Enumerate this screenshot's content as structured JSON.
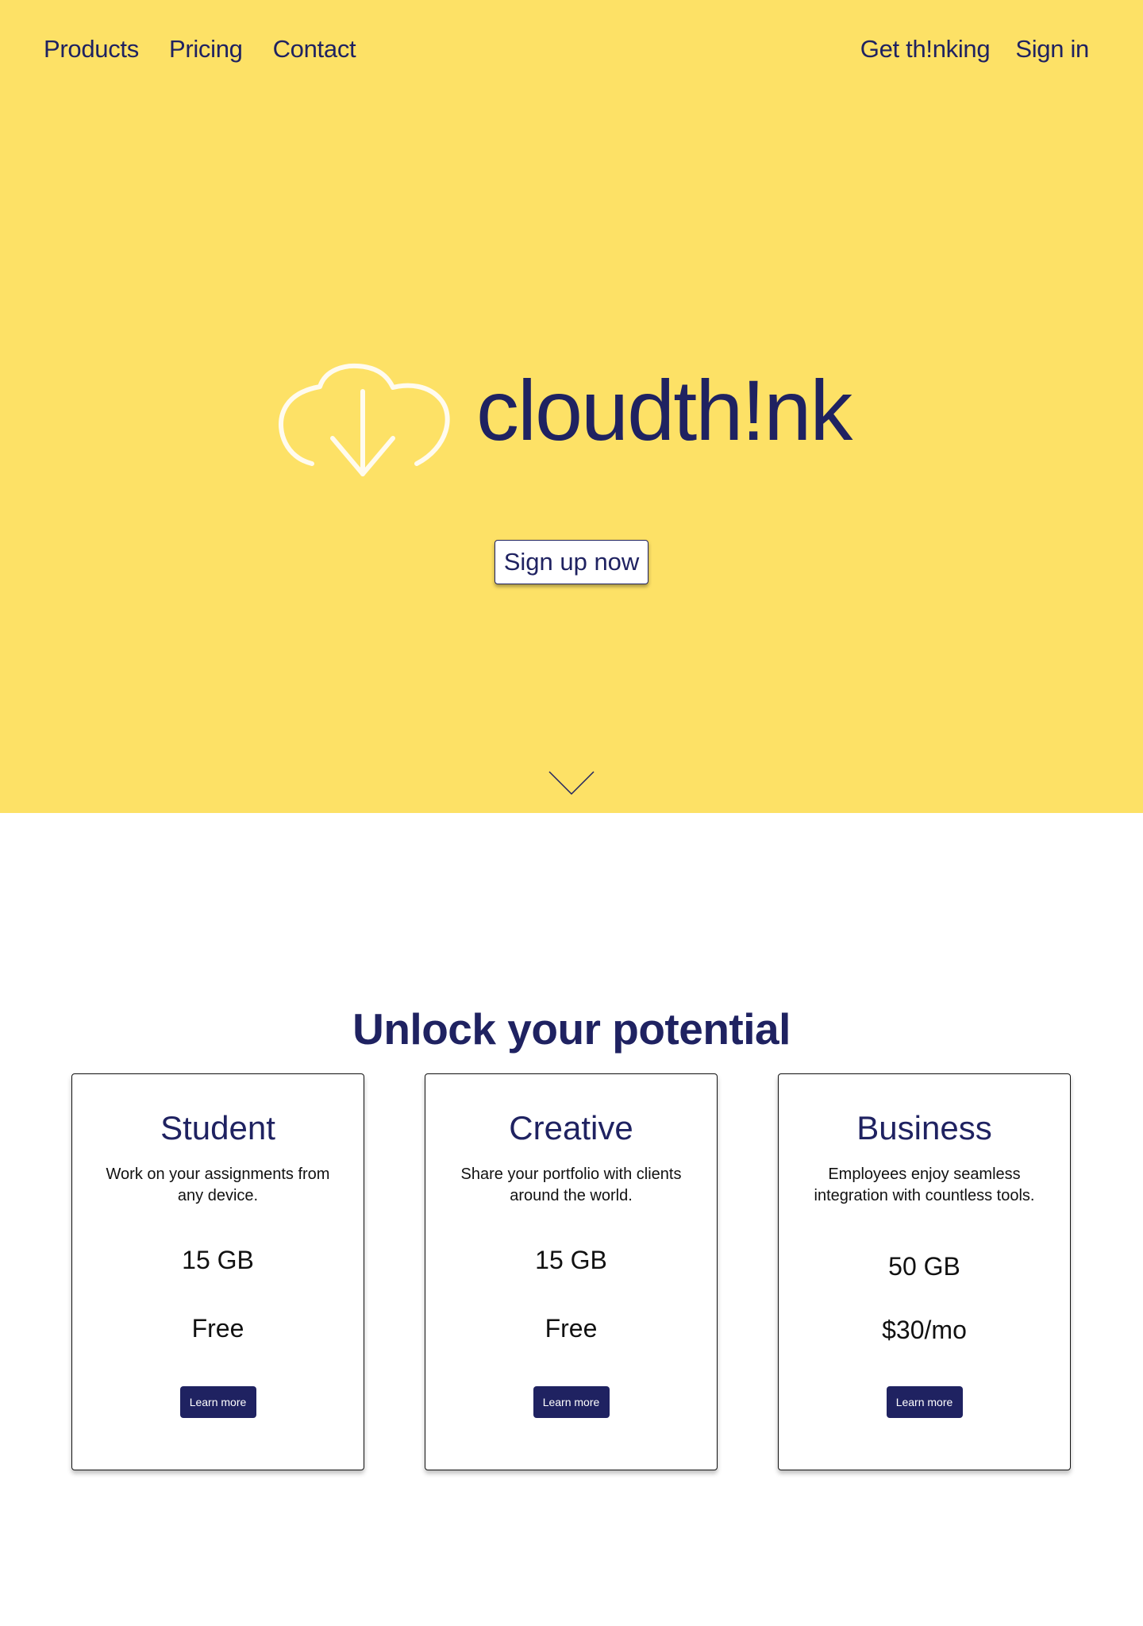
{
  "brand": {
    "name": "cloudth!nk",
    "logo_icon": "cloud-download-icon",
    "colors": {
      "primary": "#1f2261",
      "hero_bg": "#fde166",
      "background": "#ffffff",
      "icon": "#fffbef"
    }
  },
  "nav": {
    "left": [
      {
        "label": "Products"
      },
      {
        "label": "Pricing"
      },
      {
        "label": "Contact"
      }
    ],
    "right": [
      {
        "label": "Get th!nking"
      },
      {
        "label": "Sign in"
      }
    ]
  },
  "hero": {
    "cta_label": "Sign up now",
    "scroll_icon": "chevron-down-icon"
  },
  "plans_section": {
    "title": "Unlock your potential",
    "plans": [
      {
        "name": "Student",
        "description": "Work on your assignments from any device.",
        "storage": "15 GB",
        "price": "Free",
        "cta": "Learn more"
      },
      {
        "name": "Creative",
        "description": "Share your portfolio with clients around the world.",
        "storage": "15 GB",
        "price": "Free",
        "cta": "Learn more"
      },
      {
        "name": "Business",
        "description": "Employees enjoy seamless integration with countless tools.",
        "storage": "50 GB",
        "price": "$30/mo",
        "cta": "Learn more"
      }
    ]
  }
}
